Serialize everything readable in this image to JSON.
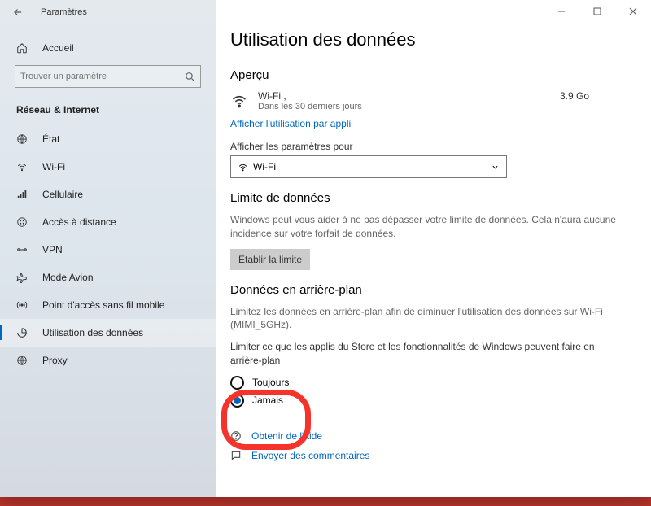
{
  "window": {
    "title": "Paramètres"
  },
  "sidebar": {
    "home": "Accueil",
    "search_placeholder": "Trouver un paramètre",
    "category": "Réseau & Internet",
    "items": [
      {
        "label": "État"
      },
      {
        "label": "Wi-Fi"
      },
      {
        "label": "Cellulaire"
      },
      {
        "label": "Accès à distance"
      },
      {
        "label": "VPN"
      },
      {
        "label": "Mode Avion"
      },
      {
        "label": "Point d'accès sans fil mobile"
      },
      {
        "label": "Utilisation des données"
      },
      {
        "label": "Proxy"
      }
    ],
    "active_index": 7
  },
  "page": {
    "title": "Utilisation des données",
    "overview": {
      "heading": "Aperçu",
      "network": "Wi-Fi ,",
      "period": "Dans les 30 derniers jours",
      "value": "3.9 Go",
      "link": "Afficher l'utilisation par appli"
    },
    "settings_for": {
      "label": "Afficher les paramètres pour",
      "selected": "Wi-Fi"
    },
    "limit": {
      "heading": "Limite de données",
      "desc": "Windows peut vous aider à ne pas dépasser votre limite de données. Cela n'aura aucune incidence sur votre forfait de données.",
      "button": "Établir la limite"
    },
    "background": {
      "heading": "Données en arrière-plan",
      "desc1": "Limitez les données en arrière-plan afin de diminuer l'utilisation des données sur Wi-Fi (MIMI_5GHz).",
      "desc2": "Limiter ce que les applis du Store et les fonctionnalités de Windows peuvent faire en arrière-plan",
      "options": [
        "Toujours",
        "Jamais"
      ],
      "selected_index": 1
    },
    "footer": {
      "help": "Obtenir de l'aide",
      "feedback": "Envoyer des commentaires"
    }
  }
}
